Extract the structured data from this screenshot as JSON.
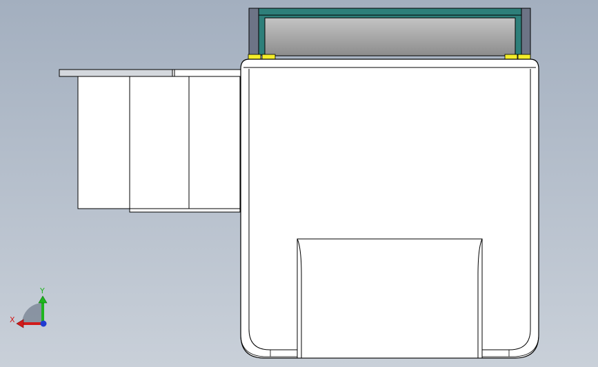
{
  "viewport": {
    "background_top": "#a3afbf",
    "background_bottom": "#c9d0d9"
  },
  "model": {
    "body_fill": "#ffffff",
    "edge_color": "#000000",
    "frame_color": "#2e7f7a",
    "glass_top": "#c4c4c4",
    "glass_bottom": "#8c8c8c",
    "pad_color": "#f4ee2a",
    "post_color": "#6d7486"
  },
  "triad": {
    "x_label": "X",
    "y_label": "Y",
    "x_color": "#d11b1b",
    "y_color": "#1fb51f",
    "z_color": "#1f3bd1"
  }
}
